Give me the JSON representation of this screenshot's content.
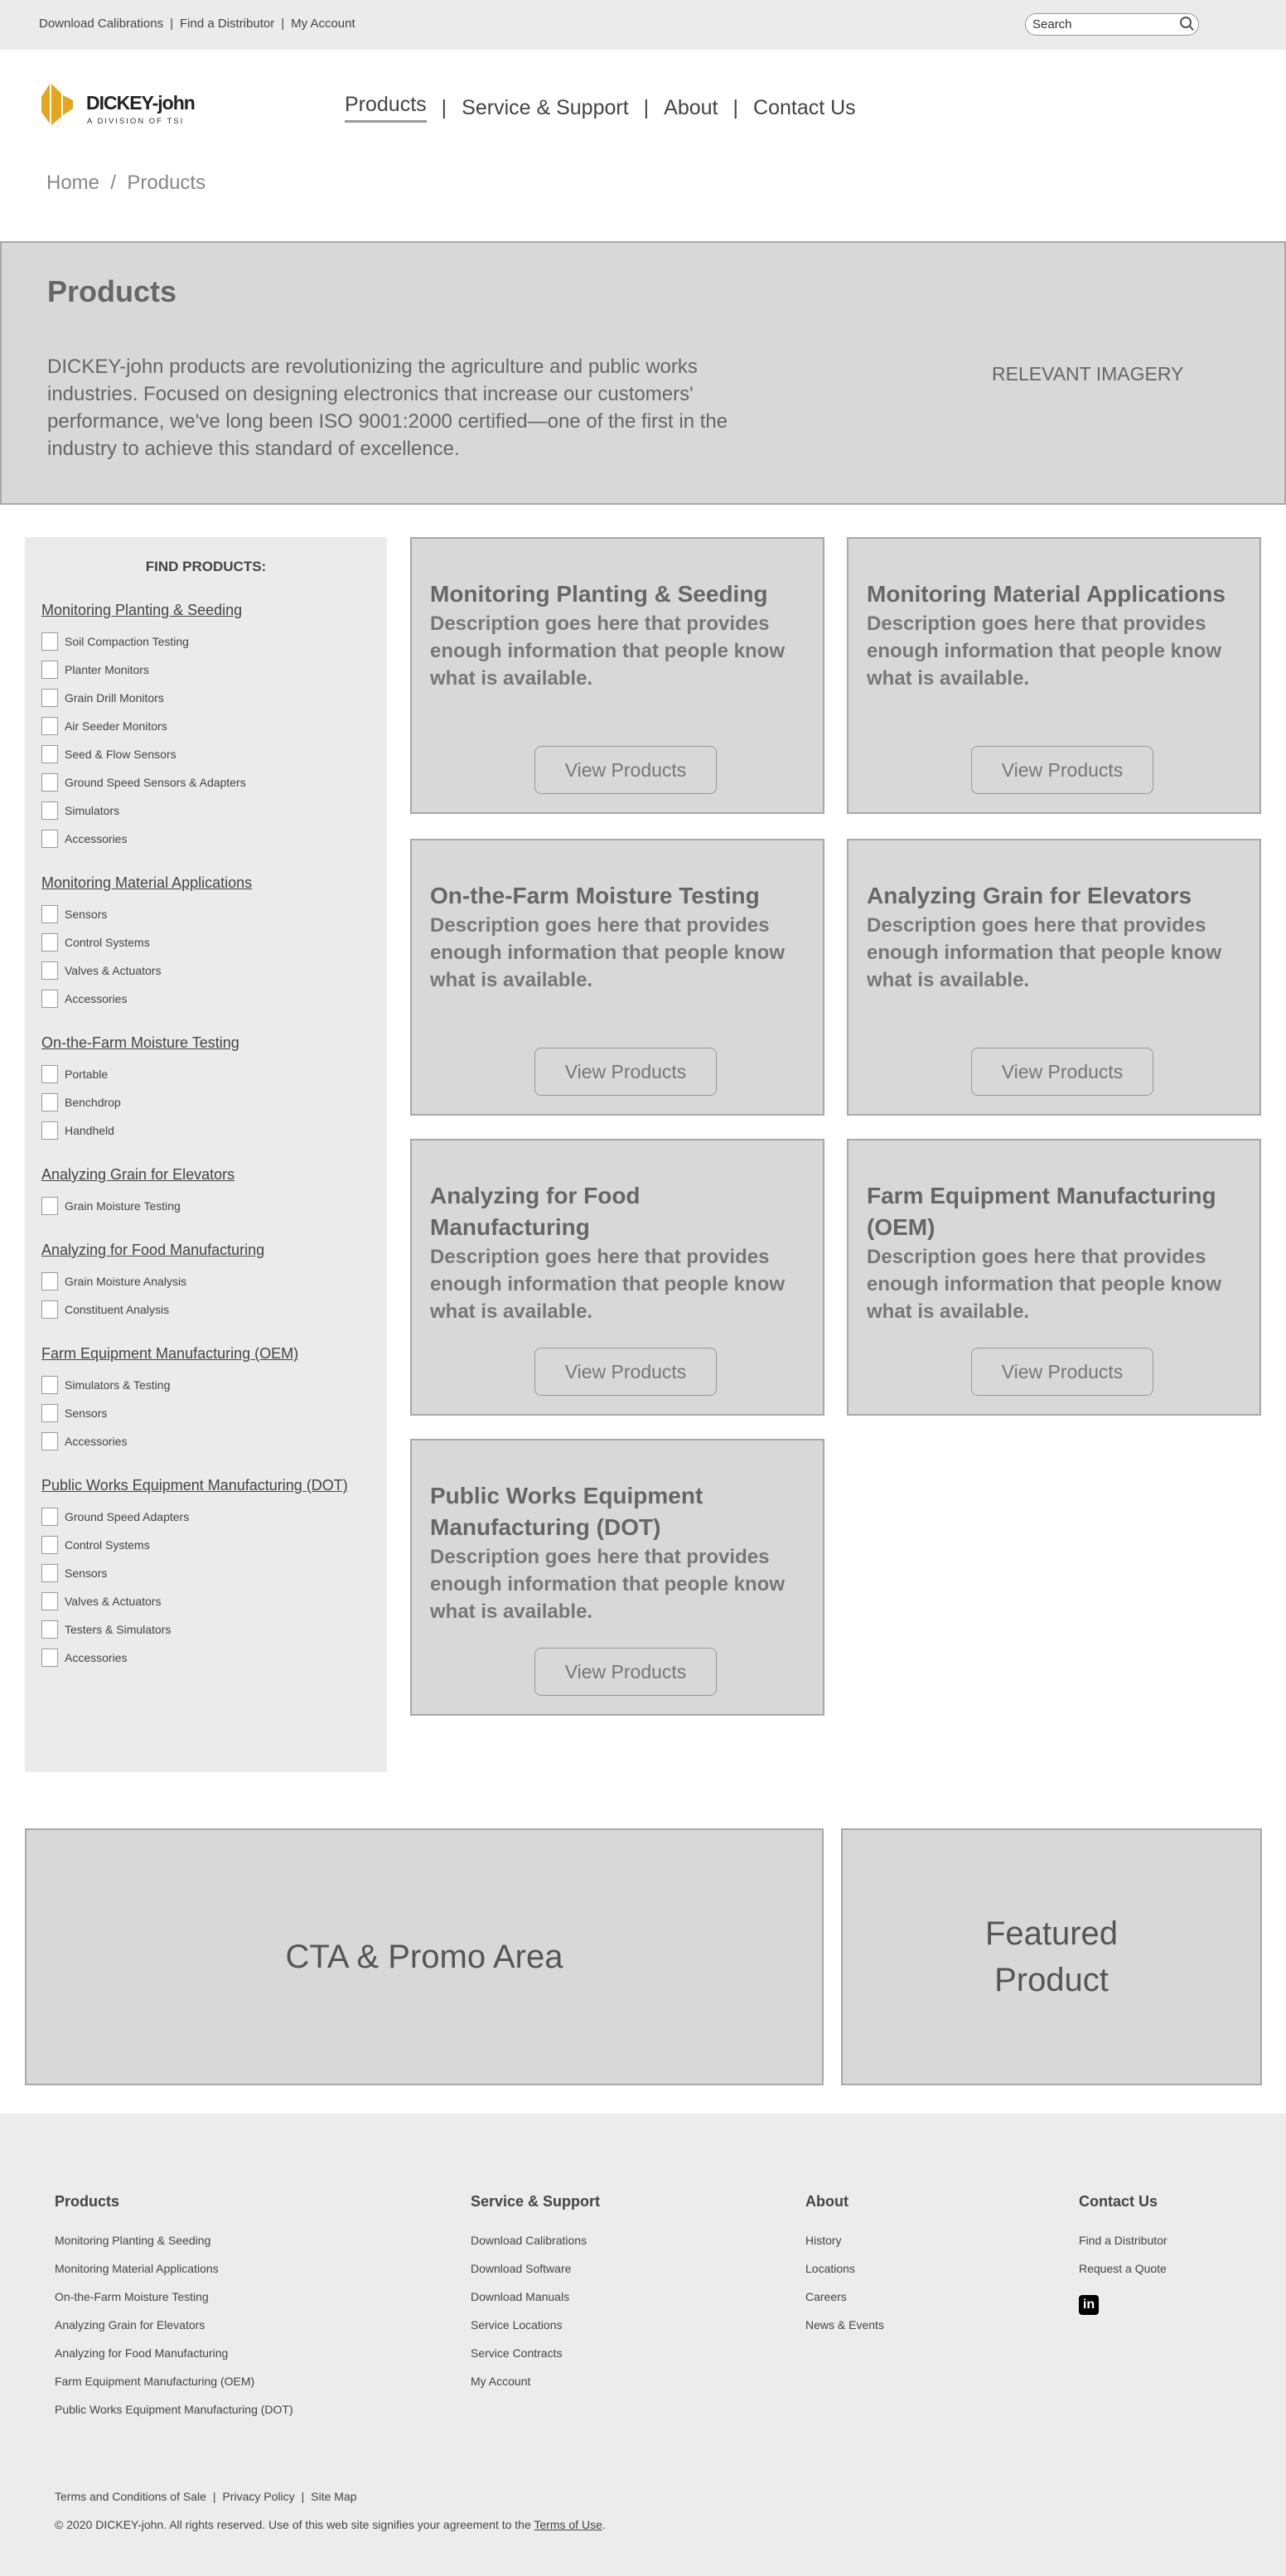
{
  "utility": {
    "links": [
      "Download Calibrations",
      "Find a Distributor",
      "My Account"
    ],
    "search_placeholder": "Search"
  },
  "logo": {
    "name": "DICKEY-john",
    "tagline": "A DIVISION OF TSI",
    "color": "#e8a41c"
  },
  "nav": [
    "Products",
    "Service & Support",
    "About",
    "Contact Us"
  ],
  "breadcrumb": [
    "Home",
    "Products"
  ],
  "hero": {
    "title": "Products",
    "text": "DICKEY-john products are revolutionizing the agriculture and public works industries. Focused on designing electronics that increase our customers' performance, we've long been ISO 9001:2000 certified—one of the first in the industry to achieve this standard of excellence.",
    "image_label": "RELEVANT IMAGERY"
  },
  "sidebar": {
    "title": "FIND PRODUCTS:",
    "sections": [
      {
        "title": "Monitoring Planting & Seeding",
        "items": [
          "Soil Compaction Testing",
          "Planter Monitors",
          "Grain Drill Monitors",
          "Air Seeder Monitors",
          "Seed & Flow Sensors",
          "Ground Speed Sensors & Adapters",
          "Simulators",
          "Accessories"
        ]
      },
      {
        "title": "Monitoring Material Applications",
        "items": [
          "Sensors",
          "Control Systems",
          "Valves & Actuators",
          "Accessories"
        ]
      },
      {
        "title": "On-the-Farm Moisture Testing",
        "items": [
          "Portable",
          "Benchdrop",
          "Handheld"
        ]
      },
      {
        "title": "Analyzing Grain for Elevators",
        "items": [
          "Grain Moisture Testing"
        ]
      },
      {
        "title": "Analyzing for Food Manufacturing",
        "items": [
          "Grain Moisture Analysis",
          "Constituent Analysis"
        ]
      },
      {
        "title": "Farm Equipment Manufacturing (OEM)",
        "items": [
          "Simulators & Testing",
          "Sensors",
          "Accessories"
        ]
      },
      {
        "title": "Public Works Equipment Manufacturing (DOT)",
        "items": [
          "Ground Speed Adapters",
          "Control Systems",
          "Sensors",
          "Valves & Actuators",
          "Testers & Simulators",
          "Accessories"
        ]
      }
    ]
  },
  "cards": [
    {
      "title": "Monitoring Planting & Seeding",
      "desc": "Description goes here that provides enough information that people know what is available.",
      "button": "View Products"
    },
    {
      "title": "Monitoring Material Applications",
      "desc": "Description goes here that provides enough information that people know what is available.",
      "button": "View Products"
    },
    {
      "title": "On-the-Farm Moisture Testing",
      "desc": "Description goes here that provides enough information that people know what is available.",
      "button": "View Products"
    },
    {
      "title": "Analyzing Grain for Elevators",
      "desc": "Description goes here that provides enough information that people know what is available.",
      "button": "View Products"
    },
    {
      "title": "Analyzing for Food Manufacturing",
      "desc": "Description goes here that provides enough information that people know what is available.",
      "button": "View Products"
    },
    {
      "title": "Farm Equipment Manufacturing (OEM)",
      "desc": "Description goes here that provides enough information that people know what is available.",
      "button": "View Products"
    },
    {
      "title": "Public Works Equipment Manufacturing (DOT)",
      "desc": "Description goes here that provides enough information that people know what is available.",
      "button": "View Products"
    }
  ],
  "promo": {
    "cta": "CTA & Promo Area",
    "featured": "Featured Product"
  },
  "footer": {
    "columns": [
      {
        "title": "Products",
        "links": [
          "Monitoring Planting & Seeding",
          "Monitoring Material Applications",
          "On-the-Farm Moisture Testing",
          "Analyzing Grain for Elevators",
          "Analyzing for Food Manufacturing",
          "Farm Equipment Manufacturing (OEM)",
          "Public Works Equipment Manufacturing (DOT)"
        ]
      },
      {
        "title": "Service & Support",
        "links": [
          "Download Calibrations",
          "Download Software",
          "Download Manuals",
          "Service Locations",
          "Service Contracts",
          "My Account"
        ]
      },
      {
        "title": "About",
        "links": [
          "History",
          "Locations",
          "Careers",
          "News & Events"
        ]
      },
      {
        "title": "Contact Us",
        "links": [
          "Find a Distributor",
          "Request a Quote"
        ],
        "social": "in"
      }
    ],
    "legal": [
      "Terms and Conditions of Sale",
      "Privacy Policy",
      "Site Map"
    ],
    "copyright": "© 2020 DICKEY-john. All rights reserved. Use of this web site signifies your agreement to the ",
    "terms_link": "Terms of Use",
    "period": "."
  }
}
